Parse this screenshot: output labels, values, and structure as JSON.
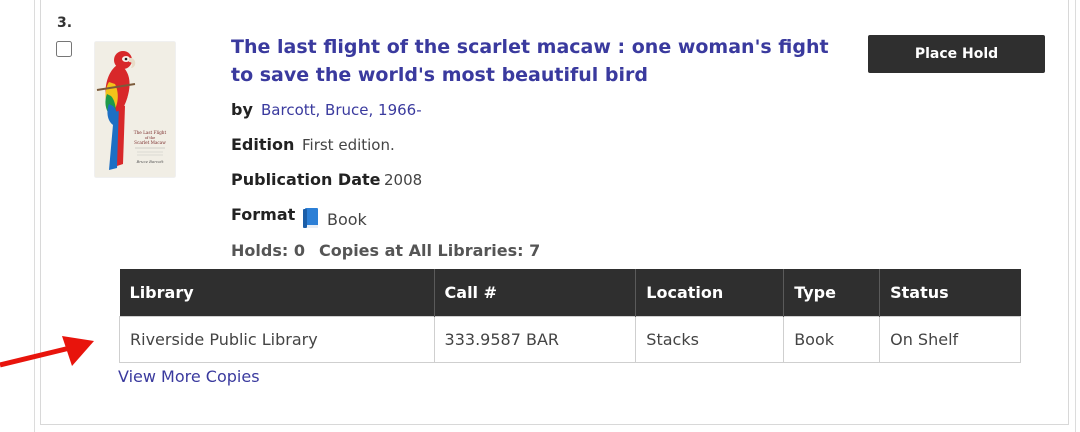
{
  "result": {
    "number": "3.",
    "title": "The last flight of the scarlet macaw : one woman's fight to save the world's most beautiful bird",
    "by_label": "by",
    "author": "Barcott, Bruce, 1966-",
    "edition_label": "Edition",
    "edition": "First edition.",
    "pubdate_label": "Publication Date",
    "pubdate": "2008",
    "format_label": "Format",
    "format": "Book",
    "format_icon": "book-icon",
    "holds": "Holds: 0",
    "copies": "Copies at All Libraries: 7",
    "place_hold_label": "Place Hold",
    "cover": {
      "title_lines": [
        "The Last Flight",
        "of the",
        "Scarlet Macaw"
      ],
      "author": "Bruce Barcott"
    }
  },
  "copies_table": {
    "headers": [
      "Library",
      "Call #",
      "Location",
      "Type",
      "Status"
    ],
    "rows": [
      [
        "Riverside Public Library",
        "333.9587 BAR",
        "Stacks",
        "Book",
        "On Shelf"
      ]
    ]
  },
  "view_more_label": "View More Copies",
  "colors": {
    "link": "#3a3a9e",
    "header_bg": "#2f2f2f",
    "button_bg": "#2f2f2f",
    "arrow": "#e8140c"
  }
}
